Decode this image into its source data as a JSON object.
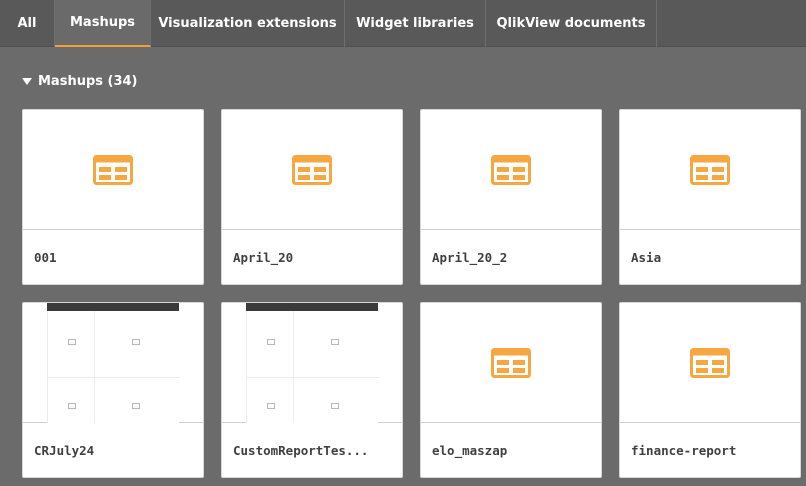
{
  "tabs": [
    {
      "label": "All",
      "active": false
    },
    {
      "label": "Mashups",
      "active": true
    },
    {
      "label": "Visualization extensions",
      "active": false
    },
    {
      "label": "Widget libraries",
      "active": false
    },
    {
      "label": "QlikView documents",
      "active": false
    }
  ],
  "section": {
    "title": "Mashups (34)",
    "expanded": true
  },
  "cards": [
    {
      "label": "001",
      "thumbnail": "mashup-icon"
    },
    {
      "label": "April_20",
      "thumbnail": "mashup-icon"
    },
    {
      "label": "April_20_2",
      "thumbnail": "mashup-icon"
    },
    {
      "label": "Asia",
      "thumbnail": "mashup-icon"
    },
    {
      "label": "CRJuly24",
      "thumbnail": "screenshot-preview"
    },
    {
      "label": "CustomReportTes...",
      "thumbnail": "screenshot-preview"
    },
    {
      "label": "elo_maszap",
      "thumbnail": "mashup-icon"
    },
    {
      "label": "finance-report",
      "thumbnail": "mashup-icon"
    }
  ],
  "colors": {
    "accent": "#f0a030",
    "icon": "#f5a742",
    "tabbar": "#595959",
    "background": "#6b6b6b"
  }
}
